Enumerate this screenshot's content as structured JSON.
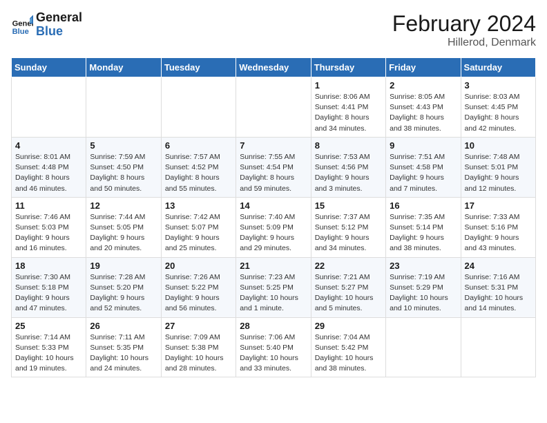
{
  "logo": {
    "line1": "General",
    "line2": "Blue"
  },
  "title": "February 2024",
  "location": "Hillerod, Denmark",
  "days_of_week": [
    "Sunday",
    "Monday",
    "Tuesday",
    "Wednesday",
    "Thursday",
    "Friday",
    "Saturday"
  ],
  "weeks": [
    [
      {
        "day": "",
        "info": ""
      },
      {
        "day": "",
        "info": ""
      },
      {
        "day": "",
        "info": ""
      },
      {
        "day": "",
        "info": ""
      },
      {
        "day": "1",
        "info": "Sunrise: 8:06 AM\nSunset: 4:41 PM\nDaylight: 8 hours\nand 34 minutes."
      },
      {
        "day": "2",
        "info": "Sunrise: 8:05 AM\nSunset: 4:43 PM\nDaylight: 8 hours\nand 38 minutes."
      },
      {
        "day": "3",
        "info": "Sunrise: 8:03 AM\nSunset: 4:45 PM\nDaylight: 8 hours\nand 42 minutes."
      }
    ],
    [
      {
        "day": "4",
        "info": "Sunrise: 8:01 AM\nSunset: 4:48 PM\nDaylight: 8 hours\nand 46 minutes."
      },
      {
        "day": "5",
        "info": "Sunrise: 7:59 AM\nSunset: 4:50 PM\nDaylight: 8 hours\nand 50 minutes."
      },
      {
        "day": "6",
        "info": "Sunrise: 7:57 AM\nSunset: 4:52 PM\nDaylight: 8 hours\nand 55 minutes."
      },
      {
        "day": "7",
        "info": "Sunrise: 7:55 AM\nSunset: 4:54 PM\nDaylight: 8 hours\nand 59 minutes."
      },
      {
        "day": "8",
        "info": "Sunrise: 7:53 AM\nSunset: 4:56 PM\nDaylight: 9 hours\nand 3 minutes."
      },
      {
        "day": "9",
        "info": "Sunrise: 7:51 AM\nSunset: 4:58 PM\nDaylight: 9 hours\nand 7 minutes."
      },
      {
        "day": "10",
        "info": "Sunrise: 7:48 AM\nSunset: 5:01 PM\nDaylight: 9 hours\nand 12 minutes."
      }
    ],
    [
      {
        "day": "11",
        "info": "Sunrise: 7:46 AM\nSunset: 5:03 PM\nDaylight: 9 hours\nand 16 minutes."
      },
      {
        "day": "12",
        "info": "Sunrise: 7:44 AM\nSunset: 5:05 PM\nDaylight: 9 hours\nand 20 minutes."
      },
      {
        "day": "13",
        "info": "Sunrise: 7:42 AM\nSunset: 5:07 PM\nDaylight: 9 hours\nand 25 minutes."
      },
      {
        "day": "14",
        "info": "Sunrise: 7:40 AM\nSunset: 5:09 PM\nDaylight: 9 hours\nand 29 minutes."
      },
      {
        "day": "15",
        "info": "Sunrise: 7:37 AM\nSunset: 5:12 PM\nDaylight: 9 hours\nand 34 minutes."
      },
      {
        "day": "16",
        "info": "Sunrise: 7:35 AM\nSunset: 5:14 PM\nDaylight: 9 hours\nand 38 minutes."
      },
      {
        "day": "17",
        "info": "Sunrise: 7:33 AM\nSunset: 5:16 PM\nDaylight: 9 hours\nand 43 minutes."
      }
    ],
    [
      {
        "day": "18",
        "info": "Sunrise: 7:30 AM\nSunset: 5:18 PM\nDaylight: 9 hours\nand 47 minutes."
      },
      {
        "day": "19",
        "info": "Sunrise: 7:28 AM\nSunset: 5:20 PM\nDaylight: 9 hours\nand 52 minutes."
      },
      {
        "day": "20",
        "info": "Sunrise: 7:26 AM\nSunset: 5:22 PM\nDaylight: 9 hours\nand 56 minutes."
      },
      {
        "day": "21",
        "info": "Sunrise: 7:23 AM\nSunset: 5:25 PM\nDaylight: 10 hours\nand 1 minute."
      },
      {
        "day": "22",
        "info": "Sunrise: 7:21 AM\nSunset: 5:27 PM\nDaylight: 10 hours\nand 5 minutes."
      },
      {
        "day": "23",
        "info": "Sunrise: 7:19 AM\nSunset: 5:29 PM\nDaylight: 10 hours\nand 10 minutes."
      },
      {
        "day": "24",
        "info": "Sunrise: 7:16 AM\nSunset: 5:31 PM\nDaylight: 10 hours\nand 14 minutes."
      }
    ],
    [
      {
        "day": "25",
        "info": "Sunrise: 7:14 AM\nSunset: 5:33 PM\nDaylight: 10 hours\nand 19 minutes."
      },
      {
        "day": "26",
        "info": "Sunrise: 7:11 AM\nSunset: 5:35 PM\nDaylight: 10 hours\nand 24 minutes."
      },
      {
        "day": "27",
        "info": "Sunrise: 7:09 AM\nSunset: 5:38 PM\nDaylight: 10 hours\nand 28 minutes."
      },
      {
        "day": "28",
        "info": "Sunrise: 7:06 AM\nSunset: 5:40 PM\nDaylight: 10 hours\nand 33 minutes."
      },
      {
        "day": "29",
        "info": "Sunrise: 7:04 AM\nSunset: 5:42 PM\nDaylight: 10 hours\nand 38 minutes."
      },
      {
        "day": "",
        "info": ""
      },
      {
        "day": "",
        "info": ""
      }
    ]
  ]
}
